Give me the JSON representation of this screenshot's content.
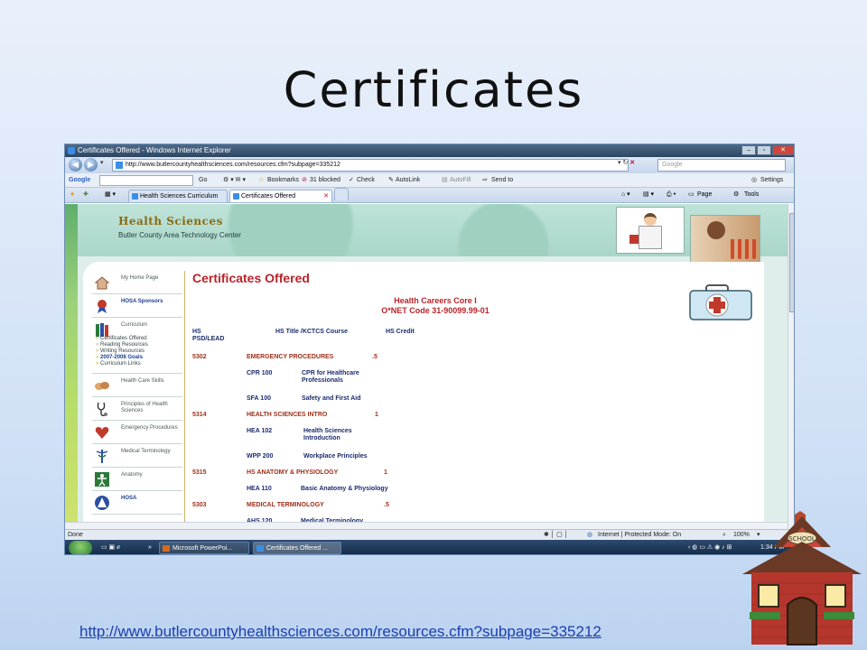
{
  "slide": {
    "title": "Certificates",
    "url": "http://www.butlercountyhealthsciences.com/resources.cfm?subpage=335212"
  },
  "browser": {
    "window_title": "Certificates Offered - Windows Internet Explorer",
    "address": "http://www.butlercountyhealthsciences.com/resources.cfm?subpage=335212",
    "search_placeholder": "Google",
    "toolbar": {
      "google": "Google",
      "go": "Go",
      "bookmarks": "Bookmarks",
      "blocked": "31 blocked",
      "check": "Check",
      "autolink": "AutoLink",
      "autofill": "AutoFill",
      "sendto": "Send to",
      "settings": "Settings"
    },
    "tabs": [
      "Health Sciences Curriculum",
      "Certificates Offered"
    ],
    "command_bar": {
      "page": "Page",
      "tools": "Tools"
    },
    "status": {
      "left": "Done",
      "zone": "Internet | Protected Mode: On",
      "zoom": "100%"
    }
  },
  "site": {
    "logo_title": "Health Sciences",
    "logo_subtitle": "Butler County Area Technology Center",
    "menu": [
      {
        "label": "My Home Page",
        "icon": "home-icon",
        "bold": false
      },
      {
        "label": "HOSA Sponsors",
        "icon": "ribbon-icon",
        "bold": true
      },
      {
        "label": "Curriculum",
        "icon": "books-icon",
        "bold": false
      },
      {
        "label": "Health Care Skills",
        "icon": "hands-icon",
        "bold": false
      },
      {
        "label": "Principles of Health Sciences",
        "icon": "stethoscope-icon",
        "bold": false
      },
      {
        "label": "Emergency Procedures",
        "icon": "heart-icon",
        "bold": false
      },
      {
        "label": "Medical Terminology",
        "icon": "caduceus-icon",
        "bold": false
      },
      {
        "label": "Anatomy",
        "icon": "anatomy-icon",
        "bold": false
      },
      {
        "label": "HOSA",
        "icon": "hosa-icon",
        "bold": true
      }
    ],
    "submenu": [
      "Certificates Offered",
      "Reading Resources",
      "Writing Resources",
      "2007-2008 Goals",
      "Curriculum Links"
    ],
    "page_title": "Certificates Offered",
    "core_title": "Health Careers Core I",
    "onet": "O*NET Code 31-90099.99-01",
    "table": {
      "header": {
        "col1": "HS PSD/LEAD",
        "col2": "HS Title /KCTCS Course",
        "col3": "HS Credit"
      },
      "courses": [
        {
          "code": "5302",
          "title": "EMERGENCY PROCEDURES",
          "credit": ".5",
          "subs": [
            {
              "code": "CPR 100",
              "title": "CPR for Healthcare Professionals"
            },
            {
              "code": "SFA 100",
              "title": "Safety and First Aid"
            }
          ]
        },
        {
          "code": "5314",
          "title": "HEALTH SCIENCES INTRO",
          "credit": "1",
          "subs": [
            {
              "code": "HEA 102",
              "title": "Health Sciences Introduction"
            },
            {
              "code": "WPP 200",
              "title": "Workplace Principles"
            }
          ]
        },
        {
          "code": "5315",
          "title": "HS ANATOMY & PHYSIOLOGY",
          "credit": "1",
          "subs": [
            {
              "code": "HEA 110",
              "title": "Basic Anatomy & Physiology"
            }
          ]
        },
        {
          "code": "5303",
          "title": "MEDICAL TERMINOLOGY",
          "credit": ".5",
          "subs": [
            {
              "code": "AHS 120",
              "title": "Medical Terminology"
            }
          ]
        }
      ]
    }
  },
  "taskbar": {
    "items": [
      "Microsoft PowerPoi...",
      "Certificates Offered ..."
    ],
    "clock": "1:34 PM"
  },
  "colors": {
    "accent_red": "#b8242a",
    "link_blue": "#1a3faf",
    "banner_green": "#a9d6c9"
  }
}
